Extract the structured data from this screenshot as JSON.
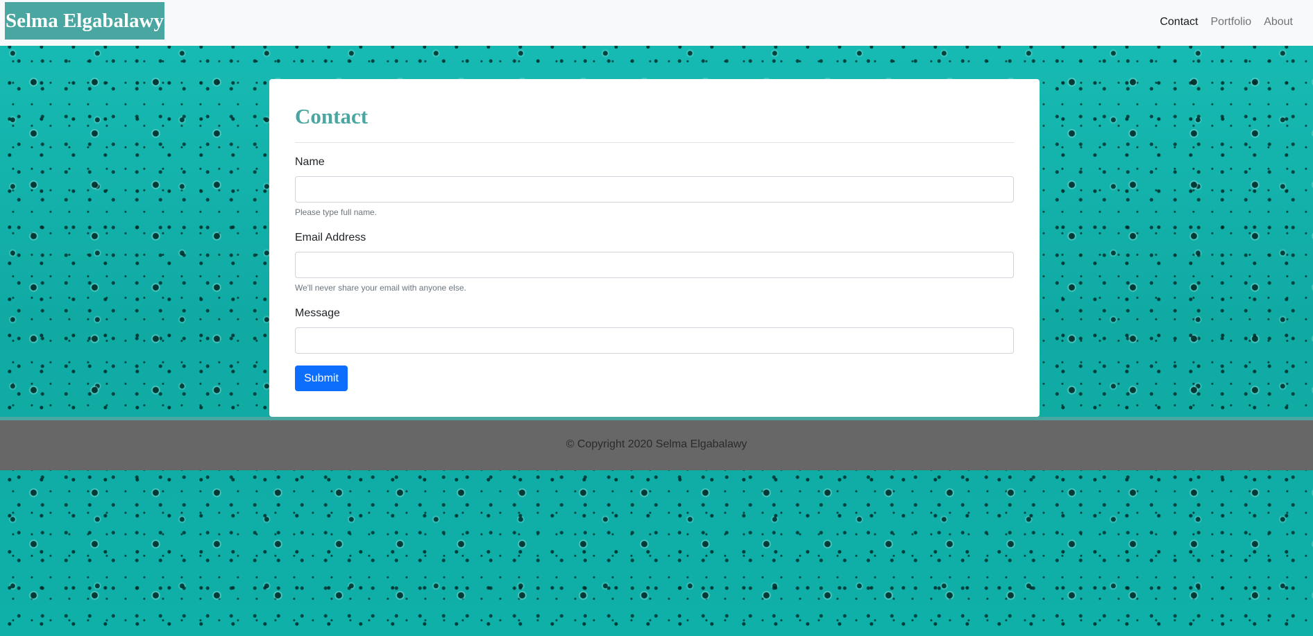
{
  "navbar": {
    "brand": "Selma Elgabalawy",
    "links": [
      {
        "label": "Contact",
        "active": true
      },
      {
        "label": "Portfolio",
        "active": false
      },
      {
        "label": "About",
        "active": false
      }
    ]
  },
  "contact_form": {
    "title": "Contact",
    "name": {
      "label": "Name",
      "value": "",
      "help": "Please type full name."
    },
    "email": {
      "label": "Email Address",
      "value": "",
      "help": "We'll never share your email with anyone else."
    },
    "message": {
      "label": "Message",
      "value": ""
    },
    "submit_label": "Submit"
  },
  "footer": {
    "text": "© Copyright 2020 Selma Elgabalawy"
  },
  "colors": {
    "brand_teal": "#4aa6a0",
    "primary_blue": "#0d6efd",
    "footer_gray": "#676767",
    "background_teal": "#13b3ab"
  }
}
